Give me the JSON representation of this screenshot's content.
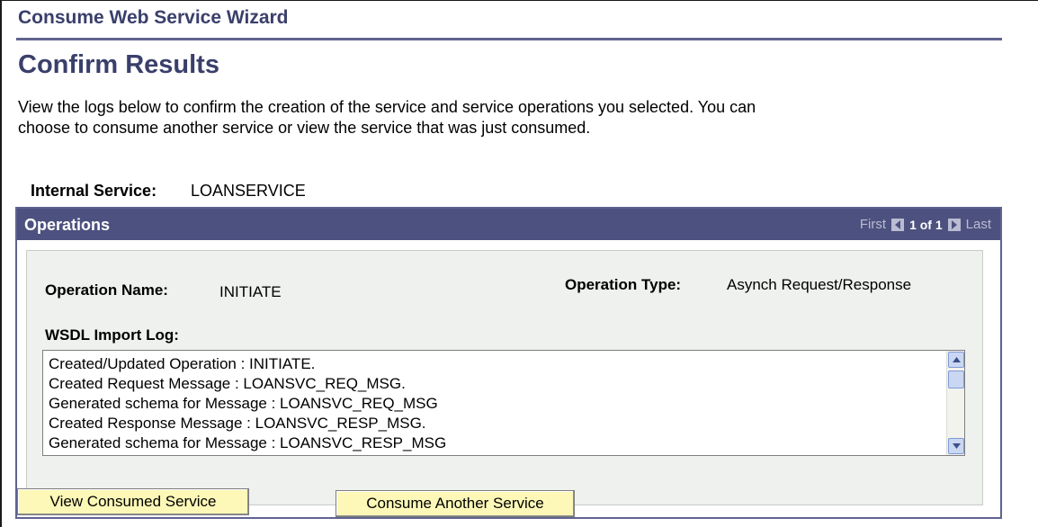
{
  "wizard": {
    "title": "Consume Web Service Wizard"
  },
  "page": {
    "title": "Confirm Results",
    "instructions": "View the logs below to confirm the creation of the service and service operations you selected. You can choose to consume another service or view the service that was just consumed."
  },
  "internal_service": {
    "label": "Internal Service:",
    "value": "LOANSERVICE"
  },
  "operations": {
    "title": "Operations",
    "nav": {
      "first": "First",
      "count": "1 of 1",
      "last": "Last"
    },
    "operation_name_label": "Operation Name:",
    "operation_name_value": "INITIATE",
    "operation_type_label": "Operation Type:",
    "operation_type_value": "Asynch Request/Response",
    "log_label": "WSDL Import Log:",
    "log_lines": [
      "Created/Updated Operation : INITIATE.",
      "Created Request Message : LOANSVC_REQ_MSG.",
      "Generated schema for Message : LOANSVC_REQ_MSG",
      "Created Response Message : LOANSVC_RESP_MSG.",
      "Generated schema for Message : LOANSVC_RESP_MSG"
    ]
  },
  "buttons": {
    "view_consumed": "View Consumed Service",
    "consume_another": "Consume Another Service"
  },
  "icons": {
    "nav_prev": "left-arrow-icon",
    "nav_next": "right-arrow-icon",
    "scroll_up": "chevron-up-icon",
    "scroll_down": "chevron-down-icon"
  },
  "colors": {
    "title": "#3a3f6b",
    "header_bar": "#4d517f",
    "panel_bg": "#eef1ee",
    "button_bg": "#fdf8b7"
  }
}
